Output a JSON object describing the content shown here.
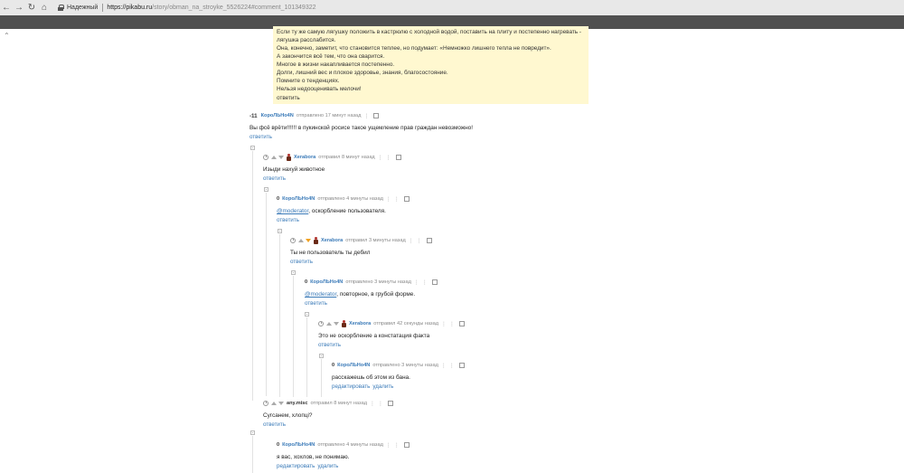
{
  "browser": {
    "secure_label": "Надежный",
    "url_host": "https://pikabu.ru",
    "url_path": "/story/obman_na_stroyke_5526224#comment_101349322"
  },
  "post": {
    "lines": [
      "Если ту же самую лягушку положить в кастрюлю с холодной водой, поставить на плиту и постепенно нагревать -",
      "лягушка расслабится.",
      "Она, конечно, заметит, что становится теплее, но подумает: «Немножко лишнего тепла не повредит».",
      "А закончится всё тем, что она сварится.",
      "Многое в жизни накапливается постепенно.",
      "Долги, лишний вес и плохое здоровье, знания, благосостояние.",
      "Помните о тенденциях.",
      "Нельзя недооценивать мелочи!"
    ],
    "reply": "ответить"
  },
  "comments": [
    {
      "rating": "-11",
      "author": "КороЛЬНо4N",
      "time": "отправлено 17 минут назад",
      "text": "Вы фсё врёти!!!!!! в пукинской росисе такое ущемление прав граждан невозможно!",
      "actions": [
        "ответить"
      ]
    },
    {
      "author": "Xerabora",
      "time": "отправил 8 минут назад",
      "text": "Изыди нахуй животное",
      "actions": [
        "ответить"
      ]
    },
    {
      "rating": "0",
      "author": "КороЛЬНо4N",
      "time": "отправлено 4 минуты назад",
      "mention": "@moderator",
      "text": ", оскорбление пользователя.",
      "actions": [
        "ответить"
      ]
    },
    {
      "author": "Xerabora",
      "time": "отправил 3 минуты назад",
      "text": "Ты не пользователь ты дебил",
      "actions": [
        "ответить"
      ]
    },
    {
      "rating": "0",
      "author": "КороЛЬНо4N",
      "time": "отправлено 3 минуты назад",
      "mention": "@moderator",
      "text": ", повторное, в грубой форме.",
      "actions": [
        "ответить"
      ]
    },
    {
      "author": "Xerabora",
      "time": "отправил 42 секунды назад",
      "text": "Это не оскорбление а констатация факта",
      "actions": [
        "ответить"
      ]
    },
    {
      "rating": "0",
      "author": "КороЛЬНо4N",
      "time": "отправлено 3 минуты назад",
      "text": "расскажешь об этом из бана.",
      "actions": [
        "редактировать",
        "удалить"
      ]
    },
    {
      "author": "any.misc",
      "time": "отправил 8 минут назад",
      "text": "Сугсанем, хлопці?",
      "actions": [
        "ответить"
      ]
    },
    {
      "rating": "0",
      "author": "КороЛЬНо4N",
      "time": "отправлено 4 минуты назад",
      "text": "я вас, хохлов, не понимаю.",
      "actions": [
        "редактировать",
        "удалить"
      ]
    }
  ]
}
